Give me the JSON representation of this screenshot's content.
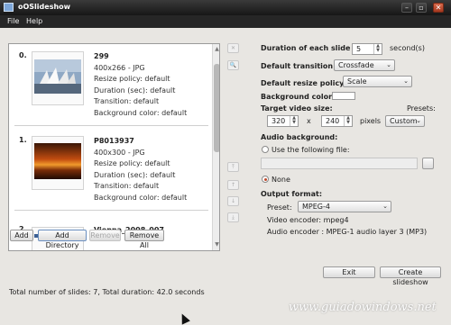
{
  "window": {
    "title": "oOSlideshow"
  },
  "menu": [
    {
      "label": "File"
    },
    {
      "label": "Help"
    }
  ],
  "slides": [
    {
      "index": "0.",
      "name": "299",
      "size": "400x266 - JPG",
      "resize": "Resize policy: default",
      "duration": "Duration (sec): default",
      "transition": "Transition: default",
      "background": "Background color: default"
    },
    {
      "index": "1.",
      "name": "P8013937",
      "size": "400x300 - JPG",
      "resize": "Resize policy: default",
      "duration": "Duration (sec): default",
      "transition": "Transition: default",
      "background": "Background color: default"
    },
    {
      "index": "2.",
      "name": "Vienna_2008_007"
    }
  ],
  "list_buttons": {
    "add": "Add",
    "add_directory": "Add Directory",
    "remove": "Remove",
    "remove_all": "Remove All"
  },
  "settings": {
    "duration_label": "Duration of each slide :",
    "duration_value": "5",
    "duration_unit": "second(s)",
    "transition_label": "Default transition :",
    "transition_value": "Crossfade",
    "resize_label": "Default resize policy:",
    "resize_value": "Scale",
    "bgcolor_label": "Background color:",
    "bgcolor_value": "#ffffff",
    "video_size_label": "Target video size:",
    "presets_label": "Presets:",
    "width": "320",
    "x_sep": "x",
    "height": "240",
    "pixels": "pixels",
    "preset_size": "Custom",
    "audio_label": "Audio background:",
    "use_file_label": "Use the following file:",
    "audio_file_value": "",
    "none_label": "None",
    "audio_selected": "None",
    "output_label": "Output format:",
    "preset_label": "Preset:",
    "preset_value": "MPEG-4",
    "video_encoder": "Video encoder:  mpeg4",
    "audio_encoder": "Audio encoder : MPEG-1 audio layer 3 (MP3)"
  },
  "actions": {
    "exit": "Exit",
    "create": "Create slideshow"
  },
  "status": "Total number of slides: 7, Total duration: 42.0 seconds",
  "watermark": "www.guiadowindows.net"
}
